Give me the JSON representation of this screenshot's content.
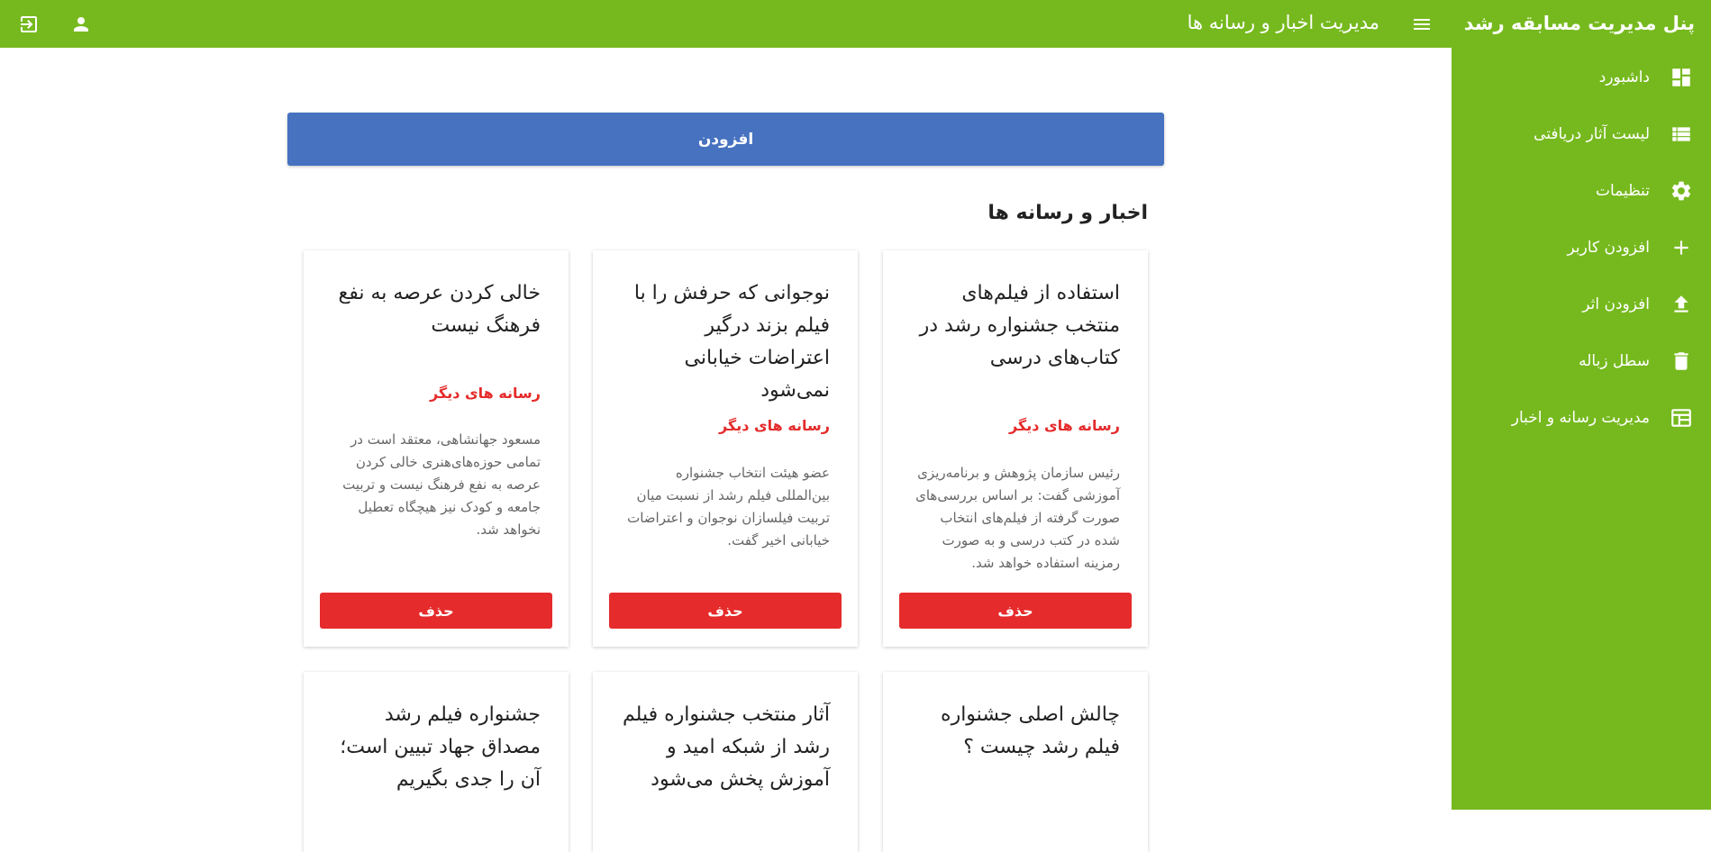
{
  "app": {
    "brand": "پنل مدیریت مسابقه رشد",
    "page_title": "مدیریت اخبار و رسانه ها"
  },
  "topbar": {
    "icons": [
      "logout-icon",
      "user-icon",
      "hamburger-menu-icon"
    ]
  },
  "sidebar": {
    "items": [
      {
        "label": "داشبورد",
        "icon": "dashboard-icon"
      },
      {
        "label": "لیست آثار دریافتی",
        "icon": "list-icon"
      },
      {
        "label": "تنظیمات",
        "icon": "gear-icon"
      },
      {
        "label": "افزودن کاربر",
        "icon": "plus-icon"
      },
      {
        "label": "افزودن اثر",
        "icon": "upload-icon"
      },
      {
        "label": "سطل زباله",
        "icon": "trash-icon"
      },
      {
        "label": "مدیریت رسانه و اخبار",
        "icon": "news-icon"
      }
    ]
  },
  "main": {
    "add_label": "افزودن",
    "section_title": "اخبار و رسانه ها",
    "delete_label": "حذف",
    "cards": [
      {
        "title": "استفاده از فیلم‌های منتخب جشنواره رشد در کتاب‌های درسی",
        "category": "رسانه های دیگر",
        "text": "رئیس سازمان پژوهش و برنامه‌ریزی آموزشی گفت: بر اساس بررسی‌های صورت گرفته از فیلم‌های انتخاب شده در کتب درسی و به صورت رمزینه استفاده خواهد شد."
      },
      {
        "title": "نوجوانی که حرفش را با فیلم بزند درگیر اعتراضات خیابانی نمی‌شود",
        "category": "رسانه های دیگر",
        "text": "عضو هیئت انتخاب جشنواره بین‌المللی فیلم رشد از نسبت میان تربیت فیلسازان نوجوان و اعتراضات خیابانی اخیر گفت."
      },
      {
        "title": "خالی کردن عرصه به نفع فرهنگ نیست",
        "category": "رسانه های دیگر",
        "text": "مسعود جهانشاهی، معتقد است در تمامی حوزه‌های‌هنری خالی کردن عرصه به نفع فرهنگ نیست و تربیت جامعه و کودک نیز هیچگاه تعطیل نخواهد شد."
      },
      {
        "title": "چالش اصلی جشنواره فیلم رشد چیست ؟",
        "category": "",
        "text": ""
      },
      {
        "title": "آثار منتخب جشنواره فیلم رشد از شبکه امید و آموزش پخش می‌شود",
        "category": "",
        "text": ""
      },
      {
        "title": "جشنواره فیلم رشد مصداق جهاد تبیین است؛ آن را جدی بگیریم",
        "category": "",
        "text": ""
      }
    ]
  },
  "colors": {
    "brand_green": "#76b91e",
    "primary_blue": "#4672c0",
    "danger_red": "#e52b2b"
  }
}
